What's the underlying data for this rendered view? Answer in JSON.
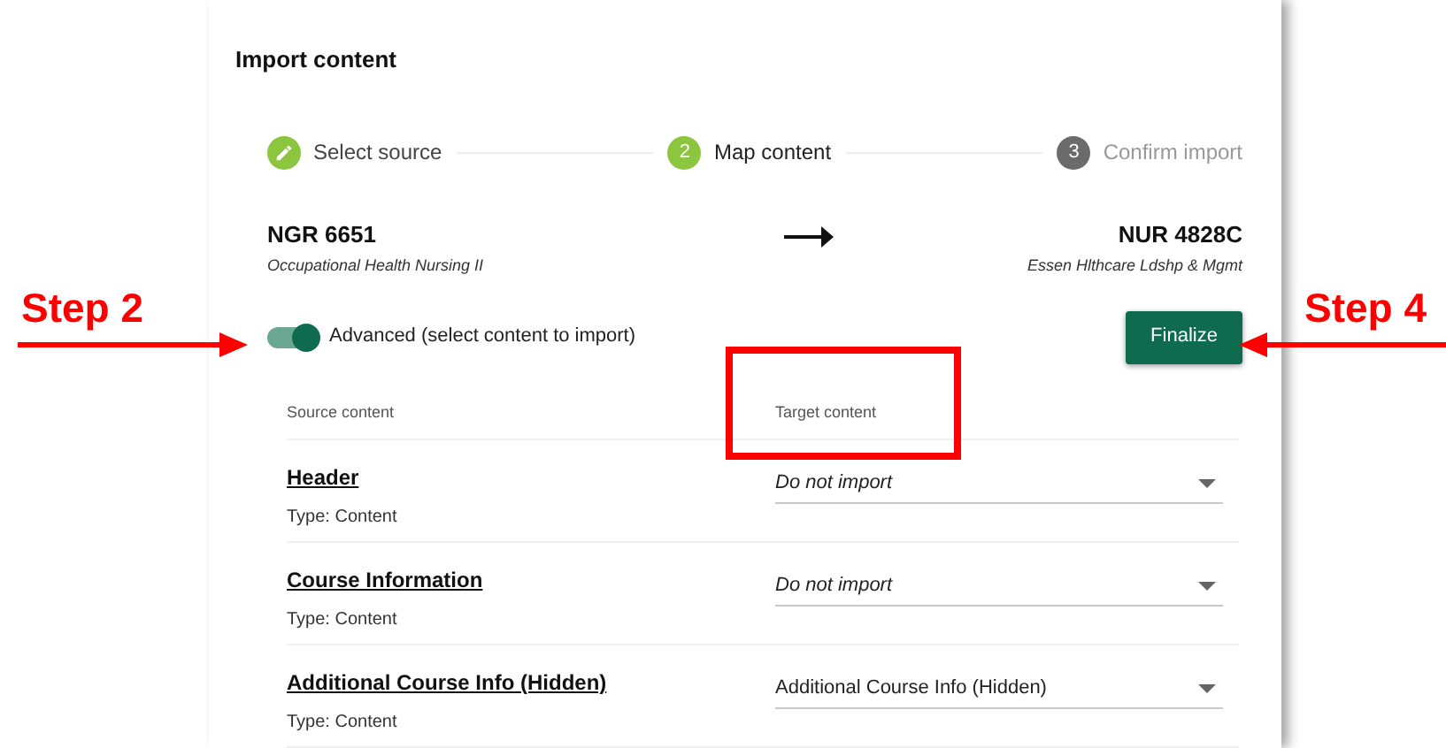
{
  "dialog": {
    "title": "Import content"
  },
  "steps": [
    {
      "kind": "done",
      "label": "Select source"
    },
    {
      "kind": "current",
      "number": "2",
      "label": "Map content"
    },
    {
      "kind": "upcoming",
      "number": "3",
      "label": "Confirm import"
    }
  ],
  "source_course": {
    "code": "NGR 6651",
    "name": "Occupational Health Nursing II"
  },
  "target_course": {
    "code": "NUR 4828C",
    "name": "Essen Hlthcare Ldshp & Mgmt"
  },
  "advanced_toggle": {
    "label": "Advanced (select content to import)",
    "on": true
  },
  "finalize_button": "Finalize",
  "columns": [
    "Source content",
    "Target content"
  ],
  "rows": [
    {
      "title": "Header",
      "type": "Type: Content",
      "target": "Do not import",
      "kind": "skip"
    },
    {
      "title": "Course Information",
      "type": "Type: Content",
      "target": "Do not import",
      "kind": "skip"
    },
    {
      "title": "Additional Course Info (Hidden)",
      "type": "Type: Content",
      "target": "Additional Course Info (Hidden)",
      "kind": "mapped"
    }
  ],
  "annotations": [
    {
      "label": "Step 2"
    },
    {
      "label": "Step 4"
    }
  ]
}
